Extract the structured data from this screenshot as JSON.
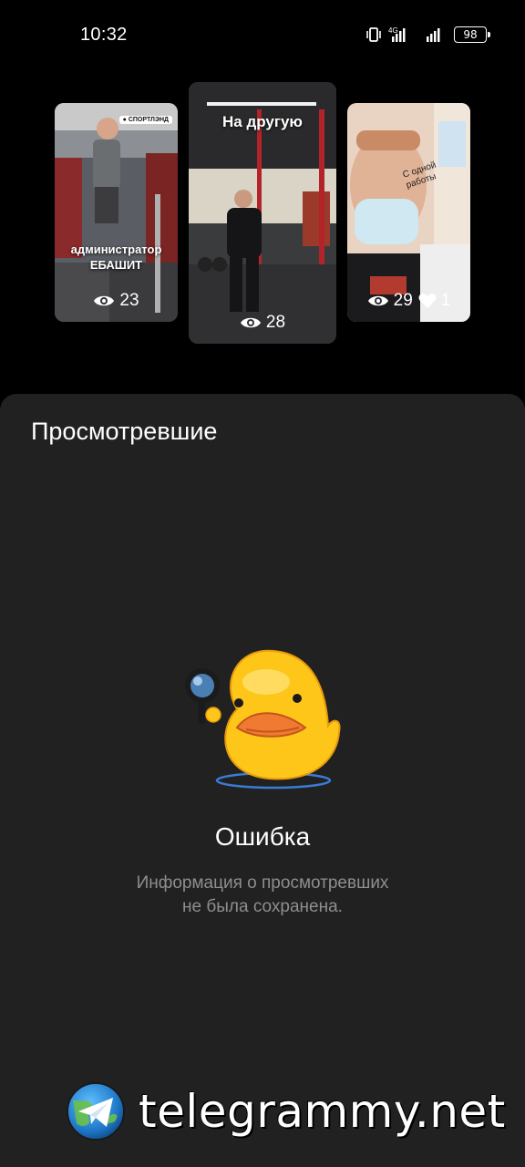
{
  "status_bar": {
    "time": "10:32",
    "network": "4G",
    "battery": "98"
  },
  "stories": [
    {
      "caption": "администратор\nЕБАШИТ",
      "brand_tag": "● СПОРТЛЭНД",
      "views": "23"
    },
    {
      "caption": "На другую",
      "views": "28"
    },
    {
      "caption": "С одной\nработы",
      "views": "29",
      "likes": "1"
    }
  ],
  "sheet": {
    "title": "Просмотревшие",
    "sticker_icon": "duck-with-magnifier",
    "error_title": "Ошибка",
    "error_text": "Информация о просмотревших\nне была сохранена."
  },
  "watermark": {
    "text": "telegrammy.net",
    "icon": "telegram-logo"
  },
  "colors": {
    "background": "#000000",
    "sheet": "#212121",
    "secondary_text": "#8e8e8e",
    "duck": "#ffc61a",
    "beak": "#f07a32"
  }
}
